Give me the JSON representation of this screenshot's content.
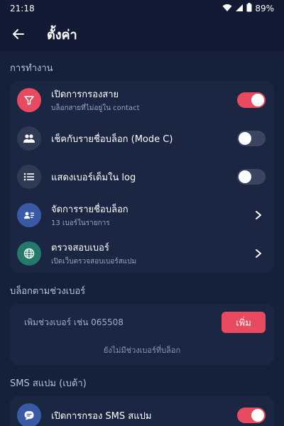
{
  "statusbar": {
    "time": "21:18",
    "battery": "89%"
  },
  "appbar": {
    "title": "ตั้งค่า"
  },
  "section_work": {
    "title": "การทำงาน"
  },
  "rows": [
    {
      "title": "เปิดการกรองสาย",
      "subtitle": "บล็อกสายที่ไม่อยู่ใน contact",
      "icon": "filter-icon",
      "icon_bg": "#e84a60",
      "control": "toggle",
      "on": true
    },
    {
      "title": "เช็คกับรายชื่อบล็อก (Mode C)",
      "subtitle": "",
      "icon": "people-icon",
      "icon_bg": "#2f3a55",
      "control": "toggle",
      "on": false
    },
    {
      "title": "แสดงเบอร์เต็มใน log",
      "subtitle": "",
      "icon": "list-icon",
      "icon_bg": "#2f3a55",
      "control": "toggle",
      "on": false
    },
    {
      "title": "จัดการรายชื่อบล็อก",
      "subtitle": "13 เบอร์ในรายการ",
      "icon": "contact-card-icon",
      "icon_bg": "#3a5aa8",
      "control": "chevron"
    },
    {
      "title": "ตรวจสอบเบอร์",
      "subtitle": "เปิดเว็บตรวจสอบเบอร์สแปม",
      "icon": "globe-icon",
      "icon_bg": "#237a6a",
      "control": "chevron"
    }
  ],
  "section_range": {
    "title": "บล็อกตามช่วงเบอร์"
  },
  "range": {
    "placeholder": "เพิ่มช่วงเบอร์ เช่น 065508",
    "add_label": "เพิ่ม",
    "empty_text": "ยังไม่มีช่วงเบอร์ที่บล็อก"
  },
  "section_sms": {
    "title": "SMS สแปม (เบต้า)"
  },
  "sms_row": {
    "title": "เปิดการกรอง SMS สแปม",
    "icon": "chat-icon",
    "icon_bg": "#3a5aa8",
    "on": true
  },
  "colors": {
    "accent": "#e84a60",
    "background": "#15203a",
    "card": "#1b2642"
  }
}
